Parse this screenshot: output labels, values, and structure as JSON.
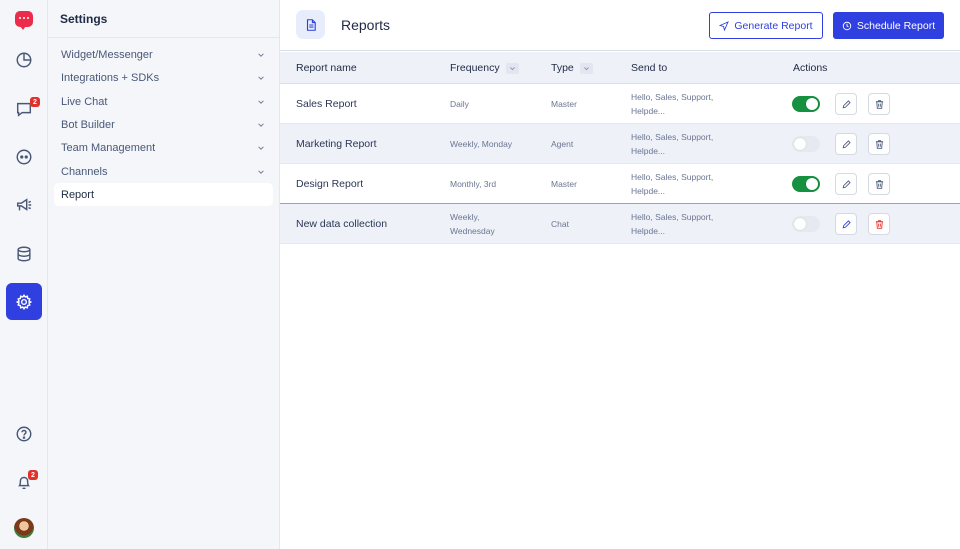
{
  "rail": {
    "chat_badge": "2",
    "bell_badge": "2"
  },
  "settings": {
    "title": "Settings",
    "items": [
      {
        "label": "Widget/Messenger"
      },
      {
        "label": "Integrations + SDKs"
      },
      {
        "label": "Live Chat"
      },
      {
        "label": "Bot Builder"
      },
      {
        "label": "Team Management"
      },
      {
        "label": "Channels"
      },
      {
        "label": "Report"
      }
    ]
  },
  "header": {
    "title": "Reports",
    "generate_label": "Generate Report",
    "schedule_label": "Schedule Report"
  },
  "table": {
    "columns": {
      "name": "Report name",
      "frequency": "Frequency",
      "type": "Type",
      "send_to": "Send to",
      "actions": "Actions"
    },
    "rows": [
      {
        "name": "Sales Report",
        "frequency_1": "Daily",
        "frequency_2": "",
        "type": "Master",
        "send_to_1": "Hello, Sales, Support,",
        "send_to_2": "Helpde...",
        "enabled": true
      },
      {
        "name": "Marketing Report",
        "frequency_1": "Weekly, Monday",
        "frequency_2": "",
        "type": "Agent",
        "send_to_1": "Hello, Sales, Support,",
        "send_to_2": "Helpde...",
        "enabled": false
      },
      {
        "name": "Design Report",
        "frequency_1": "Monthly, 3rd",
        "frequency_2": "",
        "type": "Master",
        "send_to_1": "Hello, Sales, Support,",
        "send_to_2": "Helpde...",
        "enabled": true
      },
      {
        "name": "New data collection",
        "frequency_1": "Weekly,",
        "frequency_2": "Wednesday",
        "type": "Chat",
        "send_to_1": "Hello, Sales, Support,",
        "send_to_2": "Helpde...",
        "enabled": false
      }
    ]
  },
  "colors": {
    "accent": "#2f3fe0",
    "toggle_on": "#15913f",
    "danger": "#e0322d",
    "brand": "#ec2c4a"
  }
}
